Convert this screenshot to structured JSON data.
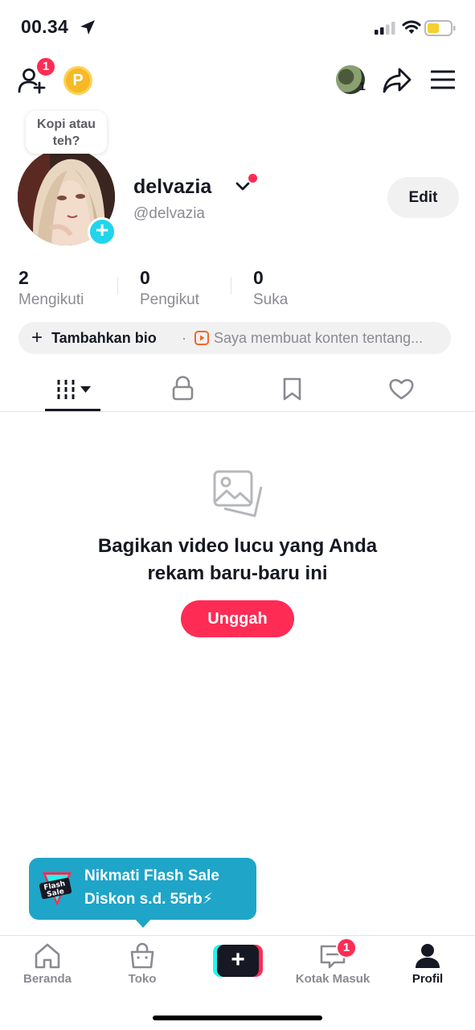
{
  "status_bar": {
    "time": "00.34"
  },
  "topbar": {
    "friend_badge": "1",
    "coin_letter": "P",
    "account_count": "1"
  },
  "profile": {
    "bubble_text": "Kopi atau teh?",
    "display_name": "delvazia",
    "handle": "@delvazia",
    "edit_label": "Edit"
  },
  "stats": [
    {
      "value": "2",
      "label": "Mengikuti"
    },
    {
      "value": "0",
      "label": "Pengikut"
    },
    {
      "value": "0",
      "label": "Suka"
    }
  ],
  "bio": {
    "plus": "+",
    "add_label": "Tambahkan bio",
    "separator": "·",
    "hint": "Saya membuat konten tentang..."
  },
  "empty_state": {
    "line1": "Bagikan video lucu yang Anda",
    "line2": "rekam baru-baru ini",
    "upload_label": "Unggah"
  },
  "flash_sale": {
    "line1": "Nikmati Flash Sale",
    "line2": "Diskon s.d. 55rb⚡"
  },
  "bottom_nav": {
    "items": [
      {
        "label": "Beranda",
        "icon": "home-icon"
      },
      {
        "label": "Toko",
        "icon": "shop-icon"
      },
      {
        "label": "",
        "icon": "create-icon"
      },
      {
        "label": "Kotak Masuk",
        "icon": "inbox-icon"
      },
      {
        "label": "Profil",
        "icon": "profile-icon"
      }
    ],
    "inbox_badge": "1",
    "create_symbol": "+"
  },
  "colors": {
    "accent": "#fe2c55",
    "cyan": "#25f4ee",
    "banner": "#1ea5c8",
    "coin": "#f7b924"
  }
}
